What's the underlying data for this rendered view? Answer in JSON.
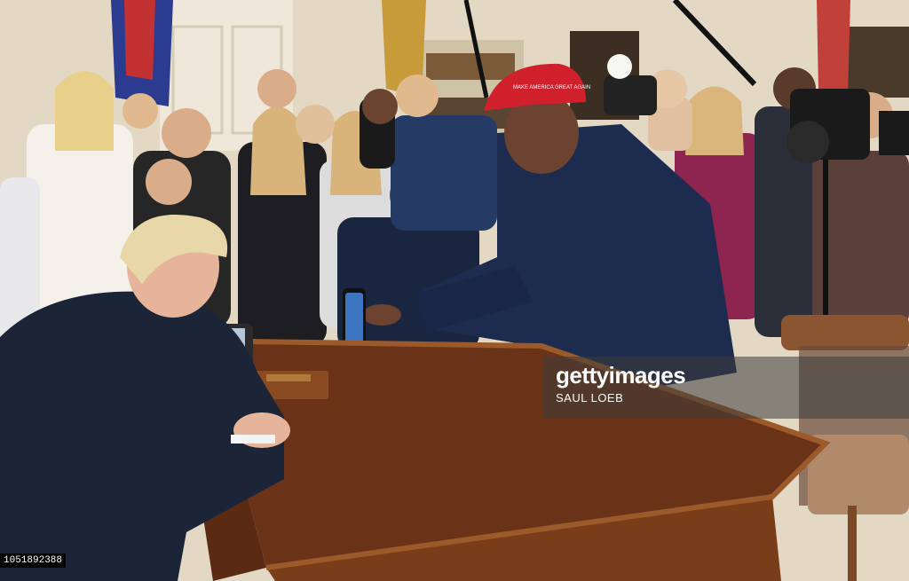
{
  "photo": {
    "hat_text": "MAKE AMERICA GREAT AGAIN",
    "watermark": {
      "logo": "gettyimages",
      "credit": "SAUL LOEB"
    },
    "image_id": "1051892388"
  },
  "colors": {
    "wall": "#e6ddc9",
    "desk_top": "#6a3318",
    "desk_edge": "#9c5a2a",
    "navy_suit": "#1c2438",
    "shirt_blue": "#1d2b4f",
    "red_cap": "#d0202c",
    "magenta_suit": "#8e2450"
  }
}
